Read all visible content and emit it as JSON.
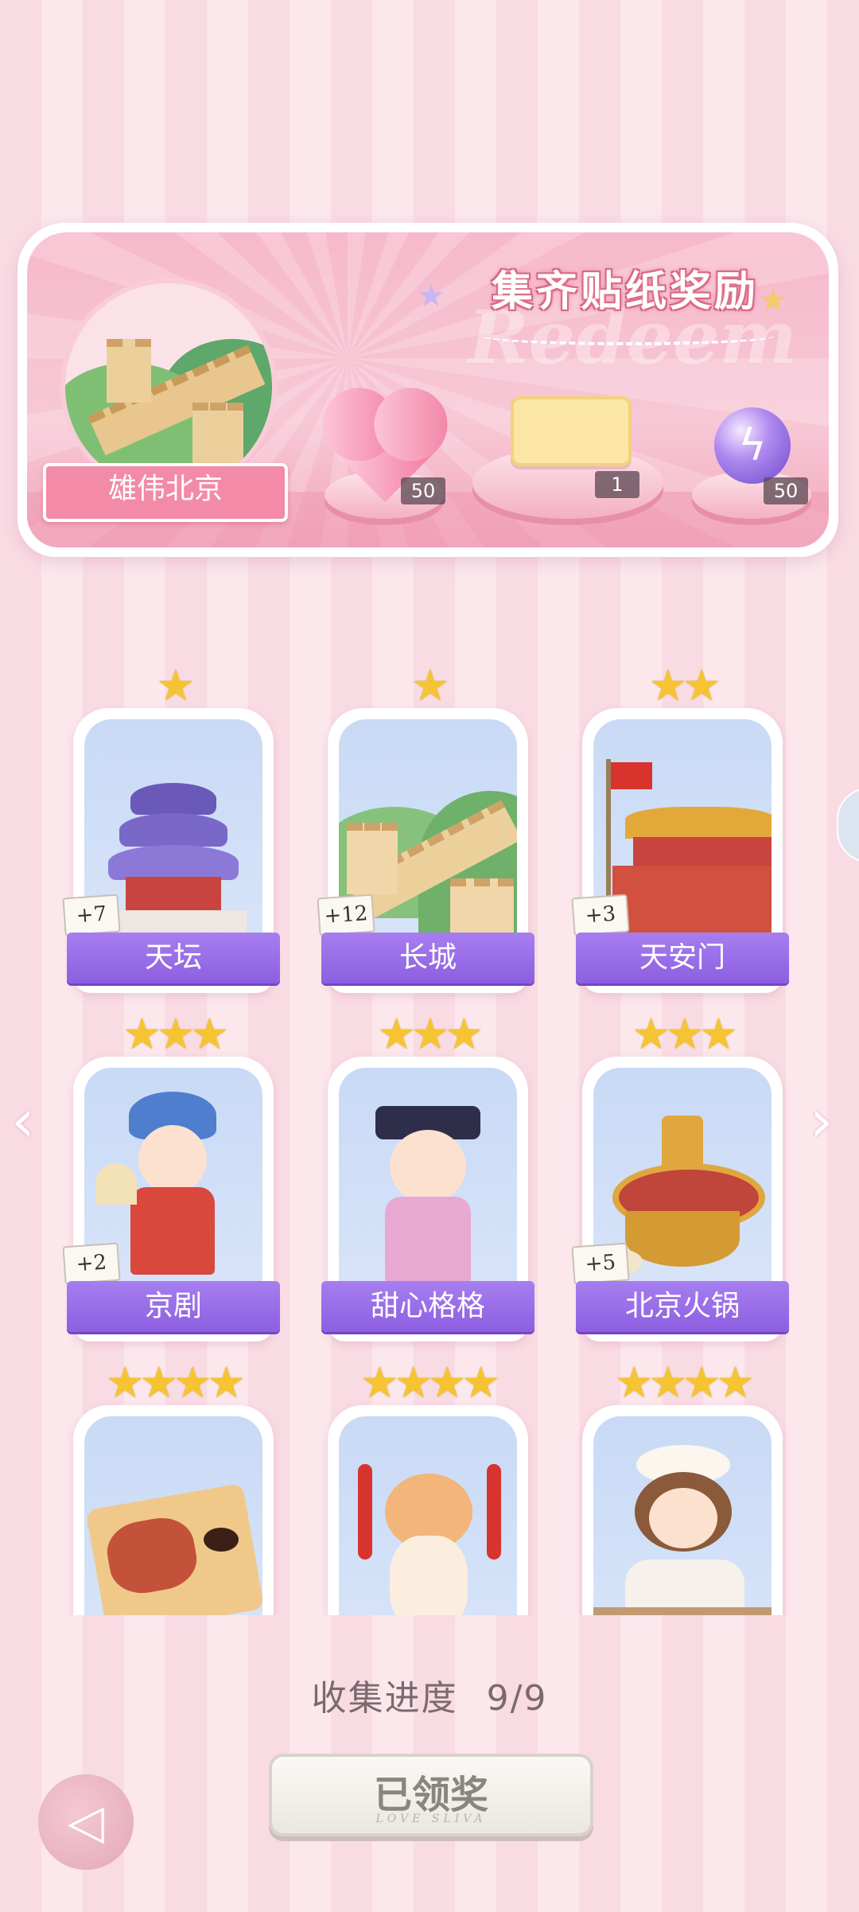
{
  "banner": {
    "title": "集齐贴纸奖励",
    "watermark": "Redeem",
    "location_label": "雄伟北京",
    "rewards": [
      {
        "icon": "pink-heart-gem-icon",
        "count": "50"
      },
      {
        "icon": "ticket-card-icon",
        "count": "1"
      },
      {
        "icon": "lightning-orb-icon",
        "count": "50"
      }
    ]
  },
  "stickers": [
    {
      "name": "天坛",
      "stars": "★",
      "bonus": "+7"
    },
    {
      "name": "长城",
      "stars": "★",
      "bonus": "+12"
    },
    {
      "name": "天安门",
      "stars": "★★",
      "bonus": "+3"
    },
    {
      "name": "京剧",
      "stars": "★★★",
      "bonus": "+2"
    },
    {
      "name": "甜心格格",
      "stars": "★★★",
      "bonus": ""
    },
    {
      "name": "北京火锅",
      "stars": "★★★",
      "bonus": "+5"
    },
    {
      "name": "",
      "stars": "★★★★",
      "bonus": ""
    },
    {
      "name": "",
      "stars": "★★★★",
      "bonus": ""
    },
    {
      "name": "",
      "stars": "★★★★",
      "bonus": ""
    }
  ],
  "progress": {
    "label": "收集进度",
    "value": "9/9"
  },
  "claim_button": {
    "label": "已领奖",
    "sub": "LOVE SLIVA"
  },
  "nav": {
    "left_arrow": "‹",
    "right_arrow": "›",
    "back_icon": "back-triangle-icon"
  },
  "colors": {
    "accent": "#8c5fe0",
    "banner": "#f6b9cb",
    "star": "#f6c433"
  }
}
